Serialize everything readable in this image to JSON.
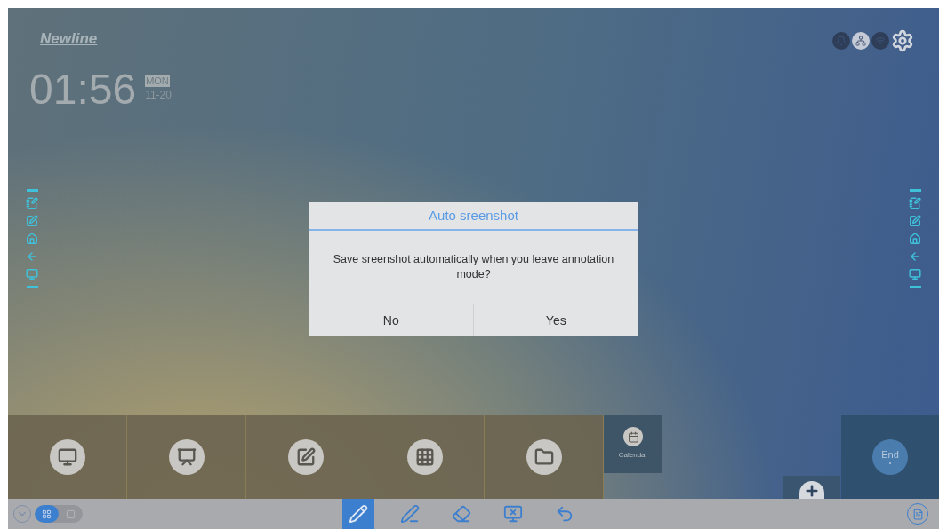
{
  "logo": "Newline",
  "clock": {
    "time": "01:56",
    "weekday": "MON",
    "date": "11-20"
  },
  "dialog": {
    "title": "Auto sreenshot",
    "message": "Save sreenshot automatically when you leave annotation mode?",
    "buttons": [
      "No",
      "Yes"
    ]
  },
  "launcher": {
    "calendar_label": "Calendar",
    "end_label": "End"
  },
  "toolbar": {
    "view_toggle": [
      {
        "selected": true
      },
      {
        "selected": false
      }
    ],
    "tools": [
      {
        "kind": "pen",
        "selected": true
      },
      {
        "kind": "marker",
        "selected": false
      },
      {
        "kind": "eraser",
        "selected": false
      },
      {
        "kind": "clear",
        "selected": false
      },
      {
        "kind": "undo",
        "selected": false
      }
    ]
  }
}
